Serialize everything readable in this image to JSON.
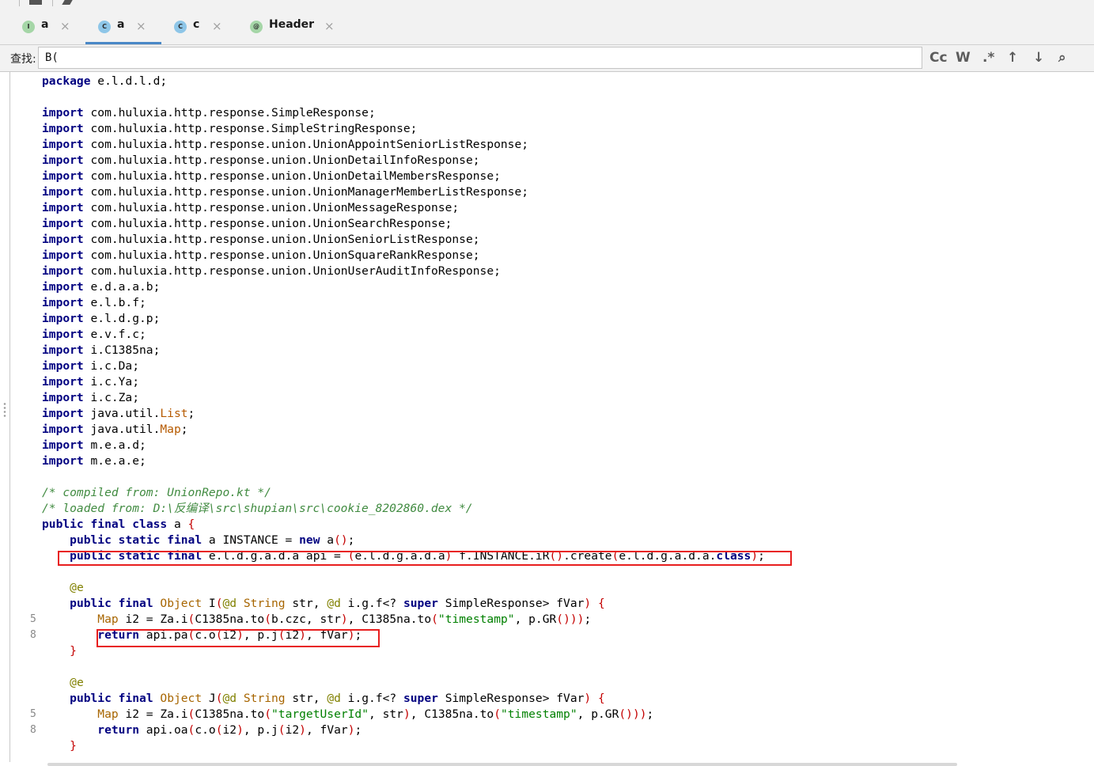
{
  "tabs": [
    {
      "icon_letter": "I",
      "icon_color": "#a5d6a7",
      "label": "a",
      "close": "×",
      "active": false
    },
    {
      "icon_letter": "C",
      "icon_color": "#8ec6e8",
      "label": "a",
      "close": "×",
      "active": true
    },
    {
      "icon_letter": "C",
      "icon_color": "#8ec6e8",
      "label": "c",
      "close": "×",
      "active": false
    },
    {
      "icon_letter": "@",
      "icon_color": "#a5d6a7",
      "label": "Header",
      "close": "×",
      "active": false
    }
  ],
  "find": {
    "label": "查找:",
    "value": "B(",
    "buttons": [
      {
        "name": "match-case-button",
        "text": "Cc"
      },
      {
        "name": "whole-word-button",
        "text": "W"
      },
      {
        "name": "regex-button",
        "text": ".*"
      },
      {
        "name": "previous-match-button",
        "text": "↑"
      },
      {
        "name": "next-match-button",
        "text": "↓"
      },
      {
        "name": "find-options-button",
        "text": "⌕"
      }
    ]
  },
  "code_lines": [
    {
      "num": "",
      "text": "package e.l.d.l.d;"
    },
    {
      "num": "",
      "text": ""
    },
    {
      "num": "",
      "text": "import com.huluxia.http.response.SimpleResponse;"
    },
    {
      "num": "",
      "text": "import com.huluxia.http.response.SimpleStringResponse;"
    },
    {
      "num": "",
      "text": "import com.huluxia.http.response.union.UnionAppointSeniorListResponse;"
    },
    {
      "num": "",
      "text": "import com.huluxia.http.response.union.UnionDetailInfoResponse;"
    },
    {
      "num": "",
      "text": "import com.huluxia.http.response.union.UnionDetailMembersResponse;"
    },
    {
      "num": "",
      "text": "import com.huluxia.http.response.union.UnionManagerMemberListResponse;"
    },
    {
      "num": "",
      "text": "import com.huluxia.http.response.union.UnionMessageResponse;"
    },
    {
      "num": "",
      "text": "import com.huluxia.http.response.union.UnionSearchResponse;"
    },
    {
      "num": "",
      "text": "import com.huluxia.http.response.union.UnionSeniorListResponse;"
    },
    {
      "num": "",
      "text": "import com.huluxia.http.response.union.UnionSquareRankResponse;"
    },
    {
      "num": "",
      "text": "import com.huluxia.http.response.union.UnionUserAuditInfoResponse;"
    },
    {
      "num": "",
      "text": "import e.d.a.a.b;"
    },
    {
      "num": "",
      "text": "import e.l.b.f;"
    },
    {
      "num": "",
      "text": "import e.l.d.g.p;"
    },
    {
      "num": "",
      "text": "import e.v.f.c;"
    },
    {
      "num": "",
      "text": "import i.C1385na;"
    },
    {
      "num": "",
      "text": "import i.c.Da;"
    },
    {
      "num": "",
      "text": "import i.c.Ya;"
    },
    {
      "num": "",
      "text": "import i.c.Za;"
    },
    {
      "num": "",
      "text": "import java.util.List;"
    },
    {
      "num": "",
      "text": "import java.util.Map;"
    },
    {
      "num": "",
      "text": "import m.e.a.d;"
    },
    {
      "num": "",
      "text": "import m.e.a.e;"
    },
    {
      "num": "",
      "text": ""
    },
    {
      "num": "",
      "text": "/* compiled from: UnionRepo.kt */"
    },
    {
      "num": "",
      "text": "/* loaded from: D:\\反编译\\src\\shupian\\src\\cookie_8202860.dex */"
    },
    {
      "num": "",
      "text": "public final class a {"
    },
    {
      "num": "",
      "text": "    public static final a INSTANCE = new a();"
    },
    {
      "num": "",
      "text": "    public static final e.l.d.g.a.d.a api = (e.l.d.g.a.d.a) f.INSTANCE.iR().create(e.l.d.g.a.d.a.class);"
    },
    {
      "num": "",
      "text": ""
    },
    {
      "num": "",
      "text": "    @e"
    },
    {
      "num": "",
      "text": "    public final Object I(@d String str, @d i.g.f<? super SimpleResponse> fVar) {"
    },
    {
      "num": "5",
      "text": "        Map i2 = Za.i(C1385na.to(b.czc, str), C1385na.to(\"timestamp\", p.GR()));"
    },
    {
      "num": "8",
      "text": "        return api.pa(c.o(i2), p.j(i2), fVar);"
    },
    {
      "num": "",
      "text": "    }"
    },
    {
      "num": "",
      "text": ""
    },
    {
      "num": "",
      "text": "    @e"
    },
    {
      "num": "",
      "text": "    public final Object J(@d String str, @d i.g.f<? super SimpleResponse> fVar) {"
    },
    {
      "num": "5",
      "text": "        Map i2 = Za.i(C1385na.to(\"targetUserId\", str), C1385na.to(\"timestamp\", p.GR()));"
    },
    {
      "num": "8",
      "text": "        return api.oa(c.o(i2), p.j(i2), fVar);"
    },
    {
      "num": "",
      "text": "    }"
    }
  ]
}
